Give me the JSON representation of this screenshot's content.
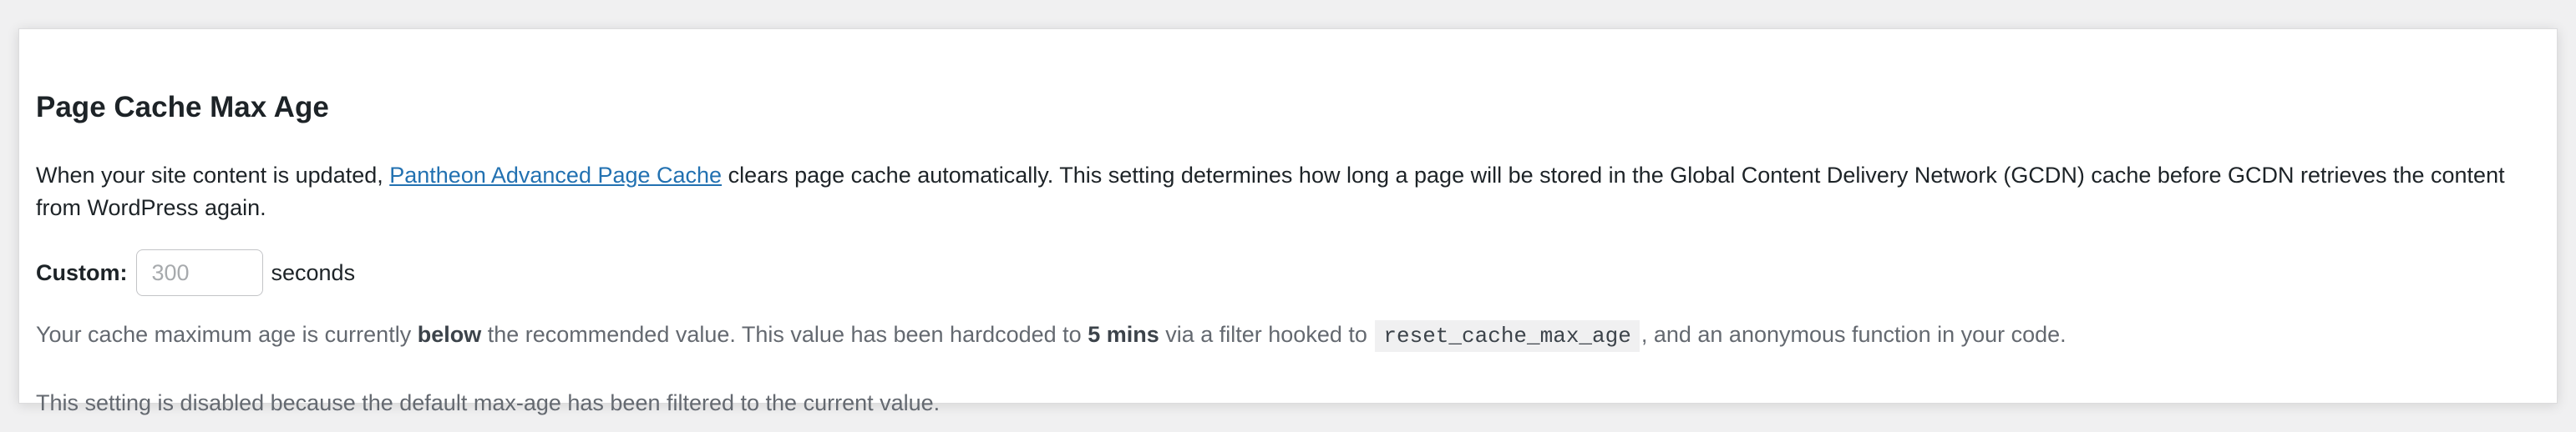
{
  "section": {
    "title": "Page Cache Max Age",
    "description": {
      "before_link": "When your site content is updated, ",
      "link_text": "Pantheon Advanced Page Cache",
      "after_link": " clears page cache automatically. This setting determines how long a page will be stored in the Global Content Delivery Network (GCDN) cache before GCDN retrieves the content from WordPress again."
    },
    "custom": {
      "label": "Custom:",
      "placeholder": "300",
      "value": "",
      "unit": "seconds"
    },
    "note": {
      "part1": "Your cache maximum age is currently ",
      "bold1": "below",
      "part2": " the recommended value. This value has been hardcoded to ",
      "bold2": "5 mins",
      "part3": " via a filter hooked to ",
      "code": "reset_cache_max_age",
      "part4": ", and an anonymous function in your code."
    },
    "disabled_note": "This setting is disabled because the default max-age has been filtered to the current value."
  }
}
